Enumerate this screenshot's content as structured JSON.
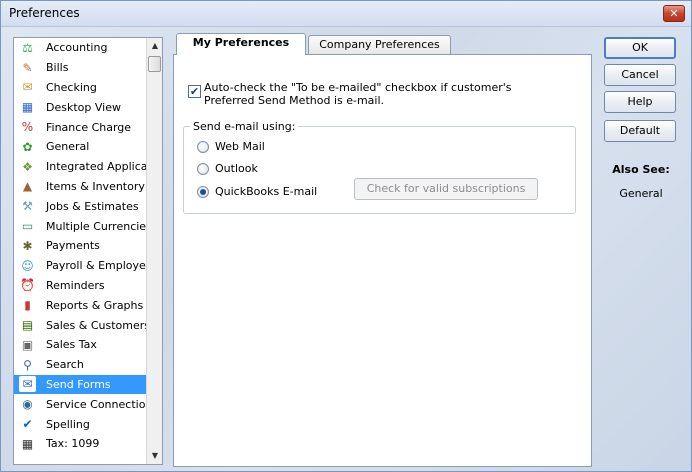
{
  "window": {
    "title": "Preferences",
    "close_glyph": "✕"
  },
  "sidebar": {
    "items": [
      {
        "label": "Accounting",
        "icon": "accounting-icon",
        "glyph": "⚖",
        "color": "#3a6"
      },
      {
        "label": "Bills",
        "icon": "bills-icon",
        "glyph": "✎",
        "color": "#c63"
      },
      {
        "label": "Checking",
        "icon": "checking-icon",
        "glyph": "✉",
        "color": "#c93"
      },
      {
        "label": "Desktop View",
        "icon": "desktop-view-icon",
        "glyph": "▦",
        "color": "#36c"
      },
      {
        "label": "Finance Charge",
        "icon": "finance-charge-icon",
        "glyph": "%",
        "color": "#c33"
      },
      {
        "label": "General",
        "icon": "general-icon",
        "glyph": "✿",
        "color": "#393"
      },
      {
        "label": "Integrated Applicatio",
        "icon": "integrated-applications-icon",
        "glyph": "❖",
        "color": "#693"
      },
      {
        "label": "Items & Inventory",
        "icon": "items-inventory-icon",
        "glyph": "▲",
        "color": "#963"
      },
      {
        "label": "Jobs & Estimates",
        "icon": "jobs-estimates-icon",
        "glyph": "⚒",
        "color": "#69c"
      },
      {
        "label": "Multiple Currencies",
        "icon": "multiple-currencies-icon",
        "glyph": "▭",
        "color": "#396"
      },
      {
        "label": "Payments",
        "icon": "payments-icon",
        "glyph": "✱",
        "color": "#663"
      },
      {
        "label": "Payroll & Employees",
        "icon": "payroll-employees-icon",
        "glyph": "☺",
        "color": "#39c"
      },
      {
        "label": "Reminders",
        "icon": "reminders-icon",
        "glyph": "⏰",
        "color": "#c90"
      },
      {
        "label": "Reports & Graphs",
        "icon": "reports-graphs-icon",
        "glyph": "▮",
        "color": "#c33"
      },
      {
        "label": "Sales & Customers",
        "icon": "sales-customers-icon",
        "glyph": "▤",
        "color": "#360"
      },
      {
        "label": "Sales Tax",
        "icon": "sales-tax-icon",
        "glyph": "▣",
        "color": "#666"
      },
      {
        "label": "Search",
        "icon": "search-icon",
        "glyph": "⚲",
        "color": "#36c"
      },
      {
        "label": "Send Forms",
        "icon": "send-forms-icon",
        "glyph": "✉",
        "color": "#36c",
        "selected": true
      },
      {
        "label": "Service Connection",
        "icon": "service-connection-icon",
        "glyph": "◉",
        "color": "#369"
      },
      {
        "label": "Spelling",
        "icon": "spelling-icon",
        "glyph": "✔",
        "color": "#06c"
      },
      {
        "label": "Tax: 1099",
        "icon": "tax-1099-icon",
        "glyph": "▦",
        "color": "#333"
      }
    ]
  },
  "tabs": {
    "my_preferences": "My Preferences",
    "company_preferences": "Company Preferences"
  },
  "my_preferences": {
    "auto_check": {
      "checked": true,
      "label_line1": "Auto-check the \"To be e-mailed\" checkbox if customer's",
      "label_line2": "Preferred Send Method is e-mail."
    },
    "send_email": {
      "title": "Send e-mail using:",
      "options": [
        "Web Mail",
        "Outlook",
        "QuickBooks E-mail"
      ],
      "selected": "QuickBooks E-mail",
      "check_subscriptions_button": "Check for valid subscriptions"
    }
  },
  "buttons": {
    "ok": "OK",
    "cancel": "Cancel",
    "help": "Help",
    "default": "Default"
  },
  "also_see": {
    "title": "Also See:",
    "link": "General"
  }
}
